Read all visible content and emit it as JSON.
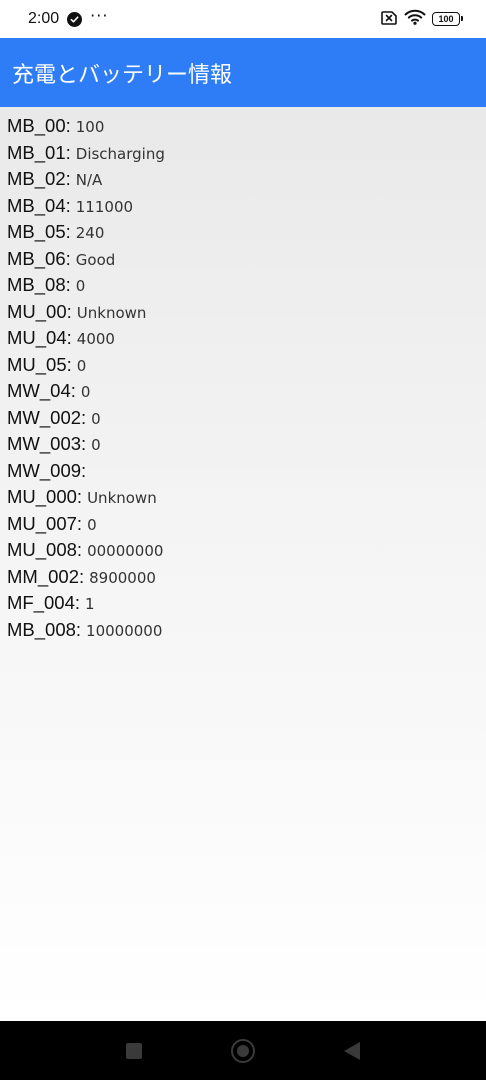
{
  "status_bar": {
    "time": "2:00",
    "more_glyph": "···",
    "battery": "100",
    "icons": [
      "check-circle-icon",
      "more-dots-icon",
      "no-sim-icon",
      "wifi-icon",
      "battery-icon"
    ]
  },
  "app_bar": {
    "title": "充電とバッテリー情報",
    "color": "#2e7cf6"
  },
  "info": {
    "rows": [
      {
        "key": "MB_00:",
        "value": "100"
      },
      {
        "key": "MB_01:",
        "value": "Discharging"
      },
      {
        "key": "MB_02:",
        "value": "N/A"
      },
      {
        "key": "MB_04:",
        "value": "111000"
      },
      {
        "key": "MB_05:",
        "value": "240"
      },
      {
        "key": "MB_06:",
        "value": "Good"
      },
      {
        "key": "MB_08:",
        "value": "0"
      },
      {
        "key": "MU_00:",
        "value": "Unknown"
      },
      {
        "key": "MU_04:",
        "value": "4000"
      },
      {
        "key": "MU_05:",
        "value": "0"
      },
      {
        "key": "MW_04:",
        "value": "0"
      },
      {
        "key": "MW_002:",
        "value": "0"
      },
      {
        "key": "MW_003:",
        "value": "0"
      },
      {
        "key": "MW_009:",
        "value": ""
      },
      {
        "key": "MU_000:",
        "value": "Unknown"
      },
      {
        "key": "MU_007:",
        "value": "0"
      },
      {
        "key": "MU_008:",
        "value": "00000000"
      },
      {
        "key": "MM_002:",
        "value": "8900000"
      },
      {
        "key": "MF_004:",
        "value": "1"
      },
      {
        "key": "MB_008:",
        "value": "10000000"
      }
    ]
  },
  "nav_bar": {
    "buttons": [
      "recents-square-icon",
      "home-circle-icon",
      "back-triangle-icon"
    ]
  }
}
